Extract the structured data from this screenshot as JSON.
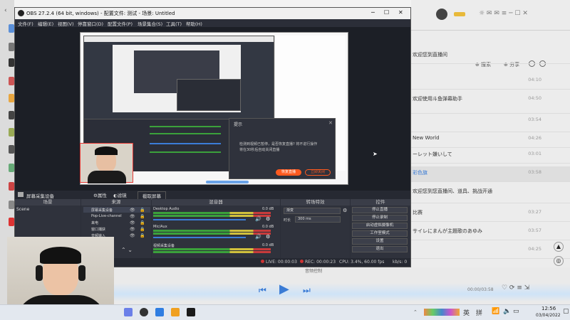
{
  "obs": {
    "title": "OBS 27.2.4 (64 bit, windows) - 配置文件: 测试 - 场景: Untitled",
    "menu": [
      "文件(F)",
      "编辑(E)",
      "视图(V)",
      "停靠窗口(D)",
      "配置文件(P)",
      "场景集合(S)",
      "工具(T)",
      "帮助(H)"
    ],
    "ctrl_bar": {
      "source": "屏幕采集设备",
      "props": "属性",
      "filters": "滤镜",
      "screen": "截取屏幕"
    },
    "docks": {
      "scenes": "场景",
      "sources": "来源",
      "mixer": "混音器",
      "transitions": "转场特效",
      "controls": "控件"
    },
    "scene_item": "Scene",
    "sources": [
      "屏幕采集设备",
      "Pop-Live-channel",
      "来电",
      "窗口捕获",
      "音频输入"
    ],
    "mixer": [
      {
        "name": "Desktop Audio",
        "db": "0.0 dB"
      },
      {
        "name": "Mic/Aux",
        "db": "0.0 dB"
      },
      {
        "name": "视频采集设备",
        "db": "0.0 dB"
      }
    ],
    "transition": {
      "type": "渐变",
      "duration_label": "时长",
      "duration": "300 ms"
    },
    "controls": [
      "停止直播",
      "停止录制",
      "启动虚拟摄像机",
      "工作室模式",
      "设置",
      "退出"
    ],
    "status": {
      "live": "LIVE: 00:00:03",
      "rec": "REC: 00:00:23",
      "cpu": "CPU: 3.4%, 60.00 fps",
      "kb": "kb/s: 0"
    }
  },
  "dialog": {
    "title": "提示",
    "line1": "检测到视频已暂停，是否恢复直播? 将不进行操作",
    "line2": "将在30秒后自动关闭直播",
    "btn_ok": "恢复直播",
    "btn_cancel": "立即关闭"
  },
  "right_panel": {
    "top_labels": [
      "搜索",
      "分享"
    ],
    "rows": [
      {
        "text": "欢迎您到直播间",
        "time": ""
      },
      {
        "text": "",
        "time": "04:10"
      },
      {
        "text": "欢迎使用斗鱼弹幕助手",
        "time": "04:50"
      },
      {
        "text": "",
        "time": "03:54"
      },
      {
        "text": "New World",
        "time": "04:26"
      },
      {
        "text": "ーレット嫌いして",
        "time": "03:01"
      },
      {
        "text": "彩色旗",
        "time": "03:58"
      },
      {
        "text": "欢迎您到您直播间、道具、挑战开通",
        "time": ""
      },
      {
        "text": "比赛",
        "time": "03:27"
      },
      {
        "text": "サイレにまんが主題歌のあゆみ",
        "time": "03:57"
      },
      {
        "text": "",
        "time": "04:25"
      }
    ]
  },
  "player": {
    "time": "00:00/03:58",
    "caption": "音频控制"
  },
  "taskbar": {
    "time": "12:56",
    "date": "03/04/2022",
    "lang": "英",
    "ime": "拼"
  },
  "colors": {
    "obs_bg": "#2b2e38",
    "accent_orange": "#ff5a1f",
    "player_blue": "#3a7bd5"
  }
}
